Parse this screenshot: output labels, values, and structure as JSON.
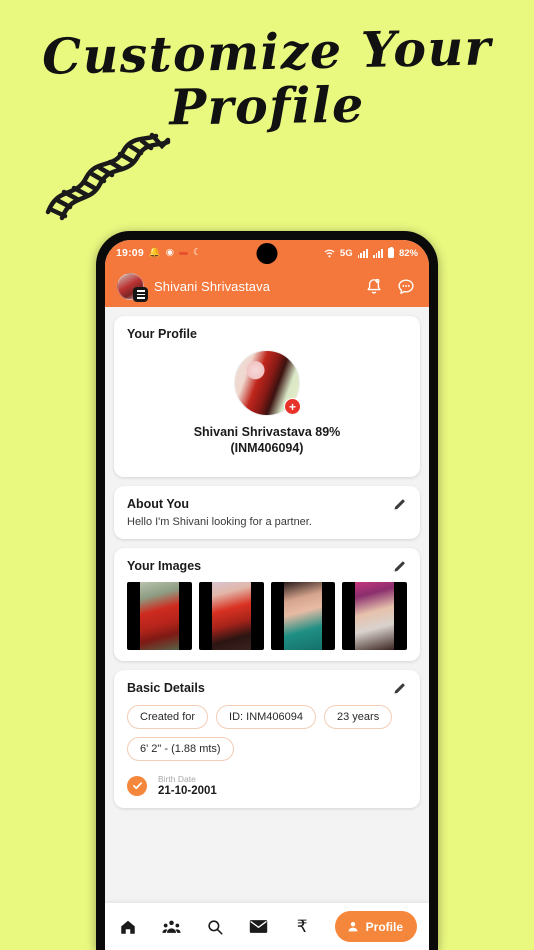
{
  "poster": {
    "background_color": "#e9f87f",
    "headline_line1": "Customize Your",
    "headline_line2": "Profile",
    "doodle": "dna-helix-arrow-doodle"
  },
  "phone": {
    "statusbar": {
      "time": "19:09",
      "left_icons": [
        "bell-icon",
        "circle-clock-icon",
        "dash-indicator",
        "moon-circle-icon"
      ],
      "network": "5G",
      "battery_percent": "82%",
      "right_icons": [
        "wifi-icon",
        "signal-bars-icon",
        "signal-bars-secondary-icon",
        "battery-icon"
      ]
    },
    "appbar": {
      "background_color": "#f4773b",
      "avatar": "user-avatar",
      "menu_badge": "hamburger-menu-icon",
      "title": "Shivani Shrivastava",
      "notification_icon": "bell-icon",
      "chat_icon": "chat-bubble-dots-icon"
    },
    "profile_card": {
      "title": "Your Profile",
      "avatar": "profile-photo",
      "add_photo_badge": "plus-icon",
      "name_percent": "Shivani Shrivastava 89%",
      "member_id": "(INM406094)"
    },
    "about_card": {
      "title": "About You",
      "text": "Hello I'm Shivani looking for a partner.",
      "edit_icon": "pencil-icon"
    },
    "images_card": {
      "title": "Your Images",
      "edit_icon": "pencil-icon",
      "images": [
        {
          "alt": "woman in red outfit standing outdoors"
        },
        {
          "alt": "woman in red shawl at event"
        },
        {
          "alt": "closeup woman in teal top with earrings"
        },
        {
          "alt": "woman in white top with pink background"
        }
      ]
    },
    "basic_details": {
      "title": "Basic Details",
      "edit_icon": "pencil-icon",
      "chips": [
        "Created for",
        "ID: INM406094",
        "23 years",
        "6' 2\" - (1.88 mts)"
      ],
      "birth_date_label": "Birth Date",
      "birth_date_value": "21-10-2001",
      "verified_icon": "check-circle-icon"
    },
    "bottom_nav": {
      "items": [
        {
          "icon": "home-icon",
          "label": ""
        },
        {
          "icon": "people-group-icon",
          "label": ""
        },
        {
          "icon": "search-icon",
          "label": ""
        },
        {
          "icon": "mail-icon",
          "label": ""
        },
        {
          "icon": "rupee-icon",
          "label": "₹"
        }
      ],
      "active": {
        "icon": "person-icon",
        "label": "Profile",
        "color": "#f4873b"
      }
    }
  }
}
